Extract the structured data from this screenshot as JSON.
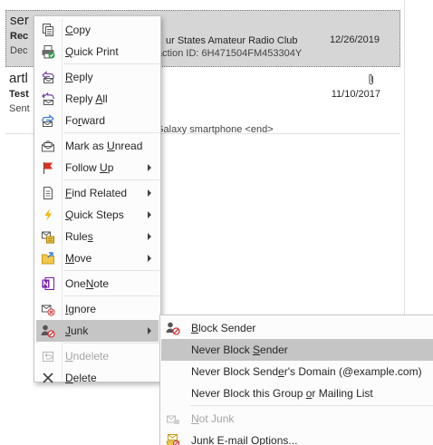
{
  "messages": [
    {
      "sender": "ser",
      "subject": "Rec",
      "preview": "Dec",
      "subject_tail": "ur States Amateur Radio Club",
      "preview_tail": "action ID: 6H471504FM453304Y",
      "date": "12/26/2019",
      "selected": true
    },
    {
      "sender": "artl",
      "subject": "Test",
      "preview": "Sent",
      "subject_tail": "",
      "preview_tail": "Galaxy smartphone <end>",
      "date": "11/10/2017",
      "has_attachment": true,
      "attachment_icon": "paperclip-icon"
    }
  ],
  "context_menu": {
    "items": [
      {
        "label": "Copy",
        "icon": "copy-icon",
        "u_index": 0,
        "submenu": false
      },
      {
        "label": "Quick Print",
        "icon": "quick-print-icon",
        "u_index": 0,
        "submenu": false
      },
      {
        "label": "Reply",
        "icon": "reply-icon",
        "u_index": 0,
        "submenu": false
      },
      {
        "label": "Reply All",
        "icon": "reply-all-icon",
        "u_index": 6,
        "submenu": false
      },
      {
        "label": "Forward",
        "icon": "forward-icon",
        "u_index": 2,
        "submenu": false
      },
      {
        "label": "Mark as Unread",
        "icon": "mark-unread-icon",
        "u_index": 8,
        "submenu": false
      },
      {
        "label": "Follow Up",
        "icon": "flag-icon",
        "u_index": 7,
        "submenu": true
      },
      {
        "label": "Find Related",
        "icon": "find-related-icon",
        "u_index": 0,
        "submenu": true
      },
      {
        "label": "Quick Steps",
        "icon": "lightning-icon",
        "u_index": 0,
        "submenu": true
      },
      {
        "label": "Rules",
        "icon": "rules-icon",
        "u_index": 4,
        "submenu": true
      },
      {
        "label": "Move",
        "icon": "move-icon",
        "u_index": 0,
        "submenu": true
      },
      {
        "label": "OneNote",
        "icon": "onenote-icon",
        "u_index": 3,
        "submenu": false
      },
      {
        "label": "Ignore",
        "icon": "ignore-icon",
        "u_index": 0,
        "submenu": false
      },
      {
        "label": "Junk",
        "icon": "junk-icon",
        "u_index": 0,
        "submenu": true,
        "hover": true
      },
      {
        "label": "Undelete",
        "icon": "undelete-icon",
        "u_index": 0,
        "submenu": false,
        "disabled": true
      },
      {
        "label": "Delete",
        "icon": "delete-icon",
        "u_index": 0,
        "submenu": false
      }
    ]
  },
  "junk_submenu": {
    "items": [
      {
        "label": "Block Sender",
        "icon": "block-sender-icon",
        "u_index": 0
      },
      {
        "label": "Never Block Sender",
        "icon": "",
        "u_index": 12,
        "hover": true
      },
      {
        "label": "Never Block Sender's Domain (@example.com)",
        "icon": "",
        "u_index": 16
      },
      {
        "label": "Never Block this Group or Mailing List",
        "icon": "",
        "u_index": 23
      },
      {
        "label": "Not Junk",
        "icon": "not-junk-icon",
        "u_index": 0,
        "disabled": true
      },
      {
        "label": "Junk E-mail Options...",
        "icon": "junk-options-icon",
        "u_index": 13
      }
    ]
  },
  "colors": {
    "selected_row": "#d6d6d6",
    "menu_hover": "#c5c5c5",
    "flag_red": "#e0301e",
    "lightning_yellow": "#f5b400",
    "onenote_purple": "#7719aa",
    "junk_red": "#d13438"
  }
}
